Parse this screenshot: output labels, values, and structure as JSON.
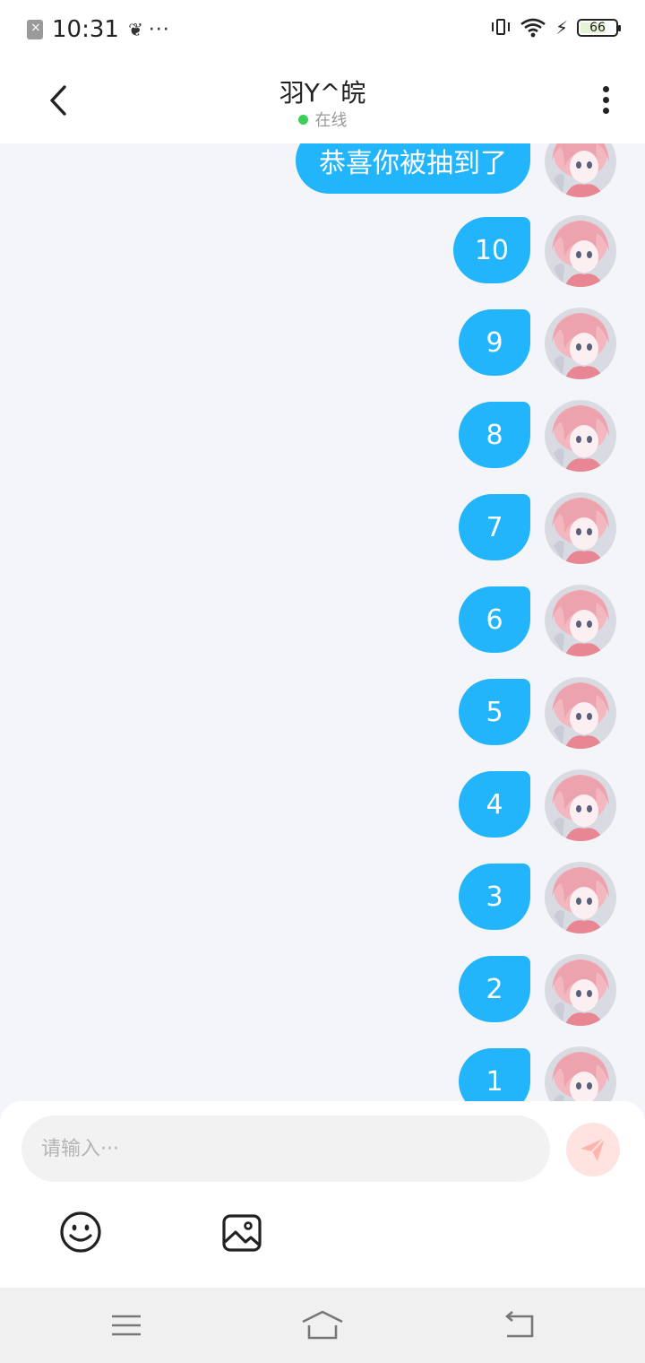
{
  "status_bar": {
    "time": "10:31",
    "more": "···",
    "battery": "66"
  },
  "header": {
    "title": "羽Y^皖",
    "status": "在线"
  },
  "messages": [
    {
      "text": "恭喜你被抽到了",
      "avatar": "avatar"
    },
    {
      "text": "10",
      "avatar": "avatar"
    },
    {
      "text": "9",
      "avatar": "avatar"
    },
    {
      "text": "8",
      "avatar": "avatar"
    },
    {
      "text": "7",
      "avatar": "avatar"
    },
    {
      "text": "6",
      "avatar": "avatar"
    },
    {
      "text": "5",
      "avatar": "avatar"
    },
    {
      "text": "4",
      "avatar": "avatar"
    },
    {
      "text": "3",
      "avatar": "avatar"
    },
    {
      "text": "2",
      "avatar": "avatar"
    },
    {
      "text": "1",
      "avatar": "avatar"
    }
  ],
  "composer": {
    "placeholder": "请输入···",
    "value": ""
  },
  "colors": {
    "bubble": "#22b5fb",
    "online": "#3bcf57",
    "send": "#ffe3e1"
  },
  "icons": [
    "back-icon",
    "more-icon",
    "send-icon",
    "emoji-icon",
    "image-icon",
    "menu-icon",
    "home-icon",
    "return-icon"
  ]
}
